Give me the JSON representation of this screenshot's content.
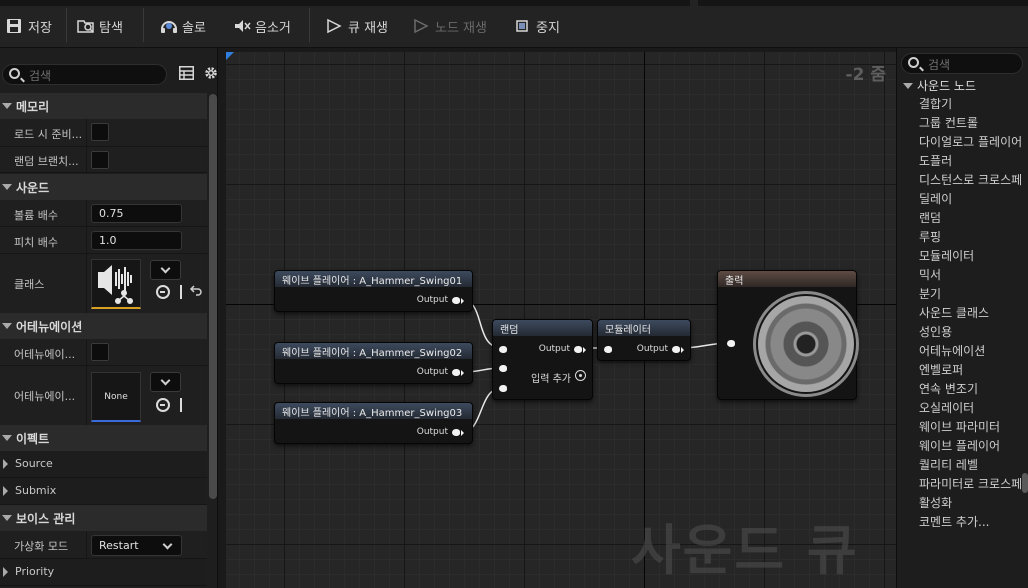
{
  "toolbar": {
    "save": "저장",
    "browse": "탐색",
    "solo": "솔로",
    "mute": "음소거",
    "play_cue": "큐 재생",
    "play_node": "노드 재생",
    "stop": "중지"
  },
  "left_panel": {
    "search_placeholder": "검색",
    "sections": {
      "memory": "메모리",
      "sound": "사운드",
      "attenuation": "어테뉴에이션",
      "effects": "이펙트",
      "voice_management": "보이스 관리"
    },
    "rows": {
      "load_prime": "로드 시 준비...",
      "random_branch": "랜덤 브랜치...",
      "volume_multiplier": "볼륨 배수",
      "volume_value": "0.75",
      "pitch_multiplier": "피치 배수",
      "pitch_value": "1.0",
      "class": "클래스",
      "atten_override": "어테뉴에이...",
      "atten_settings": "어테뉴에이...",
      "atten_none": "None",
      "source": "Source",
      "submix": "Submix",
      "virtualization_mode": "가상화 모드",
      "virtualization_value": "Restart",
      "priority": "Priority"
    }
  },
  "graph": {
    "zoom": "-2 줌",
    "watermark": "사운드 큐",
    "nodes": {
      "wave1": "웨이브 플레이어 : A_Hammer_Swing01",
      "wave2": "웨이브 플레이어 : A_Hammer_Swing02",
      "wave3": "웨이브 플레이어 : A_Hammer_Swing03",
      "output_pin": "Output",
      "random": "랜덤",
      "add_input": "입력 추가",
      "modulator": "모듈레이터",
      "output_node": "출력"
    }
  },
  "right_panel": {
    "search_placeholder": "검색",
    "category": "사운드 노드",
    "items": [
      "결합기",
      "그룹 컨트롤",
      "다이얼로그 플레이어",
      "도플러",
      "디스턴스로 크로스페이드",
      "딜레이",
      "랜덤",
      "루핑",
      "모듈레이터",
      "믹서",
      "분기",
      "사운드 클래스",
      "성인용",
      "어테뉴에이션",
      "엔벨로퍼",
      "연속 변조기",
      "오실레이터",
      "웨이브 파라미터",
      "웨이브 플레이어",
      "퀄리티 레벨",
      "파라미터로 크로스페이드",
      "활성화",
      "코멘트 추가..."
    ]
  },
  "colors": {
    "accent_blue": "#2f7fe0",
    "class_thumb_underline": "#d8a020"
  }
}
